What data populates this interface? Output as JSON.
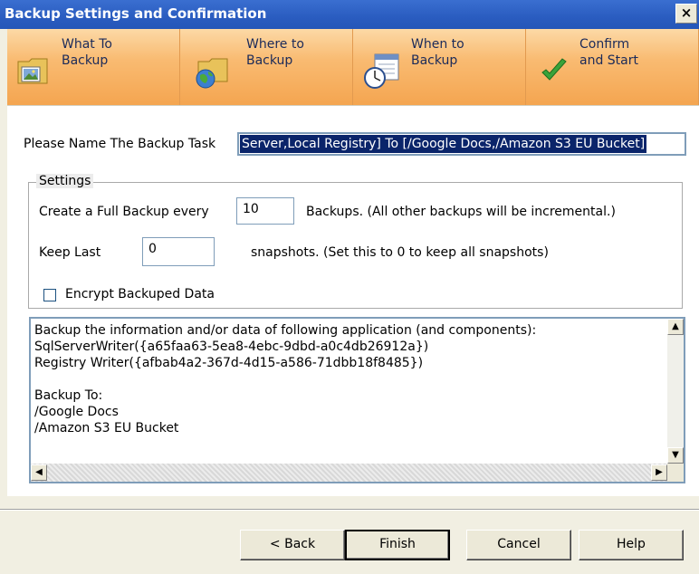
{
  "window": {
    "title": "Backup Settings and Confirmation",
    "close_glyph": "×"
  },
  "steps": [
    {
      "label": "What To\nBackup",
      "icon": "folder-picture-icon"
    },
    {
      "label": "Where to\nBackup",
      "icon": "folder-globe-icon"
    },
    {
      "label": "When to\nBackup",
      "icon": "calendar-clock-icon"
    },
    {
      "label": "Confirm\nand Start",
      "icon": "checkmark-icon"
    }
  ],
  "task": {
    "label": "Please Name The Backup Task",
    "value": "Server,Local Registry] To [/Google Docs,/Amazon S3 EU Bucket]"
  },
  "settings": {
    "legend": "Settings",
    "full_backup_label": "Create a Full Backup every",
    "full_backup_value": "10",
    "full_backup_suffix": "Backups. (All other backups will be incremental.)",
    "keep_last_label": "Keep Last",
    "keep_last_value": "0",
    "keep_last_suffix": "snapshots. (Set this to 0 to keep all snapshots)",
    "encrypt_label": "Encrypt Backuped Data",
    "encrypt_checked": false
  },
  "summary": {
    "text": "Backup the information and/or data of following application (and components):\nSqlServerWriter({a65faa63-5ea8-4ebc-9dbd-a0c4db26912a})\nRegistry Writer({afbab4a2-367d-4d15-a586-71dbb18f8485})\n\nBackup To:\n/Google Docs\n/Amazon S3 EU Bucket"
  },
  "buttons": {
    "back": "< Back",
    "finish": "Finish",
    "cancel": "Cancel",
    "help": "Help"
  },
  "colors": {
    "title_bar": "#2a5cc0",
    "step_bar": "#f9bb72",
    "selection": "#0a246a"
  }
}
